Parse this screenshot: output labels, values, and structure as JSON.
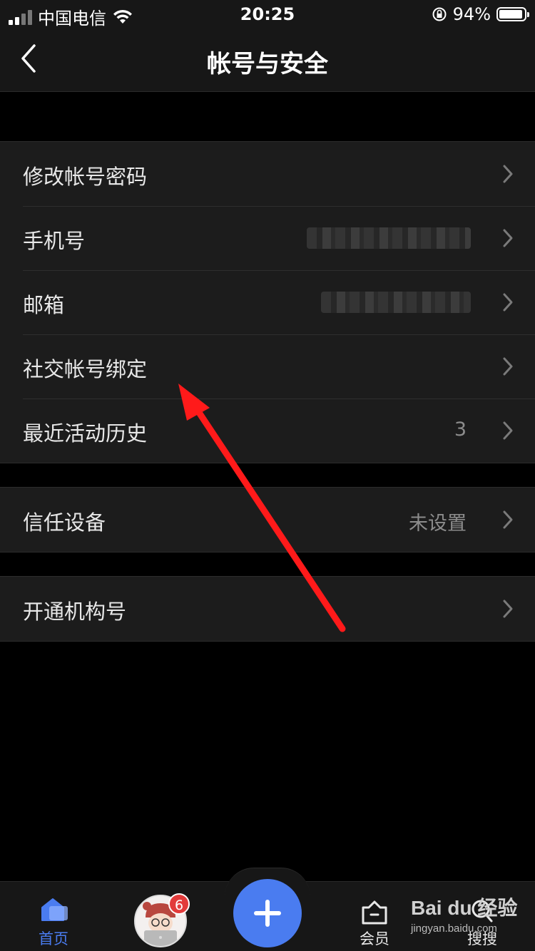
{
  "status_bar": {
    "carrier": "中国电信",
    "time": "20:25",
    "battery_percent": "94%",
    "battery_level": 0.94
  },
  "nav": {
    "title": "帐号与安全",
    "back_icon": "chevron-left-icon"
  },
  "groups": [
    {
      "rows": [
        {
          "label": "修改帐号密码",
          "value": ""
        },
        {
          "label": "手机号",
          "value": "",
          "masked": true
        },
        {
          "label": "邮箱",
          "value": "",
          "masked": true
        },
        {
          "label": "社交帐号绑定",
          "value": ""
        },
        {
          "label": "最近活动历史",
          "value": "3"
        }
      ]
    },
    {
      "rows": [
        {
          "label": "信任设备",
          "value": "未设置"
        }
      ]
    },
    {
      "rows": [
        {
          "label": "开通机构号",
          "value": ""
        }
      ]
    }
  ],
  "tab_bar": {
    "home_label": "首页",
    "avatar_badge": "6",
    "vip_label": "会员",
    "search_label": "搜搜"
  },
  "watermark": {
    "main": "Bai du 经验",
    "sub": "jingyan.baidu.com"
  },
  "colors": {
    "accent": "#4a7cf0",
    "badge": "#e23b3b",
    "annotation_arrow": "#ff1a1a",
    "background": "#000000",
    "cell": "#1c1c1c"
  }
}
